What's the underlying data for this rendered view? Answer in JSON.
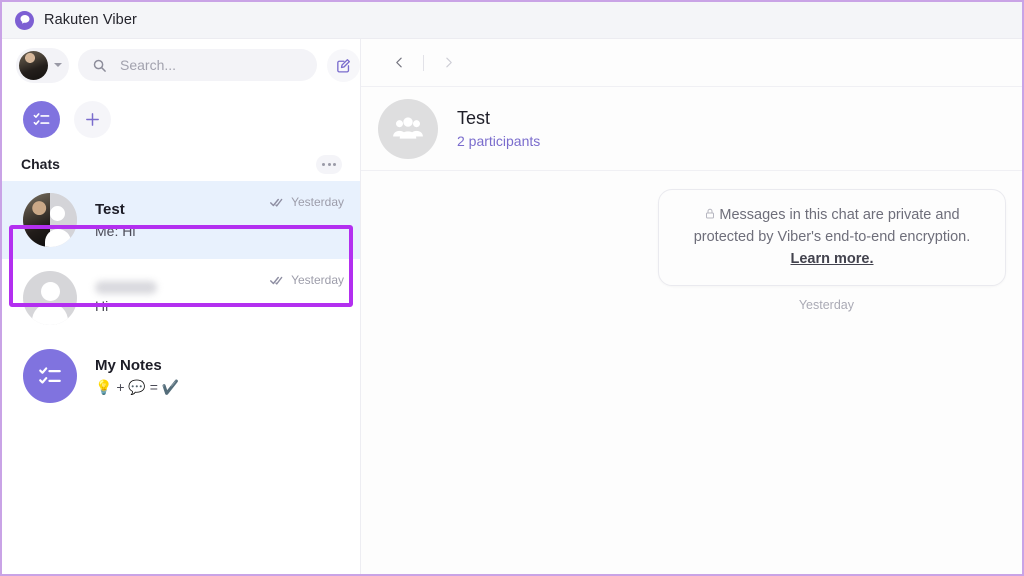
{
  "window": {
    "title": "Rakuten Viber",
    "logo_icon": "viber-phone-icon",
    "border_color": "#c9a3e6"
  },
  "sidebar": {
    "account": {
      "avatar_icon": "user-avatar",
      "dropdown_icon": "chevron-down-icon"
    },
    "search": {
      "icon": "search-icon",
      "placeholder": "Search...",
      "value": ""
    },
    "compose_icon": "compose-message-icon",
    "quick_actions": [
      {
        "name": "my-notes-shortcut",
        "icon": "checklist-icon",
        "color": "#8073df"
      },
      {
        "name": "new-chat-shortcut",
        "icon": "plus-icon",
        "color": "#8073df"
      }
    ],
    "section": {
      "title": "Chats",
      "more_icon": "ellipsis-icon"
    },
    "chats": [
      {
        "name": "Test",
        "preview": "Me: Hi",
        "time": "Yesterday",
        "status_icon": "double-check-icon",
        "avatar": "split-photo-group",
        "selected": true,
        "redacted": false
      },
      {
        "name": "",
        "preview": "Hi",
        "time": "Yesterday",
        "status_icon": "double-check-icon",
        "avatar": "default-person",
        "selected": false,
        "redacted": true
      },
      {
        "name": "My Notes",
        "preview_emoji": "💡 + 💬 = ✔️",
        "time": "",
        "status_icon": "",
        "avatar": "checklist-icon",
        "selected": false,
        "redacted": false
      }
    ],
    "highlight_color": "#b32ff0"
  },
  "conversation": {
    "nav": {
      "back_icon": "chevron-left-icon",
      "forward_icon": "chevron-right-icon"
    },
    "header": {
      "avatar_icon": "group-icon",
      "title": "Test",
      "subtitle": "2 participants",
      "subtitle_color": "#7a6ccd"
    },
    "encryption_notice": {
      "lock_icon": "lock-icon",
      "text": "Messages in this chat are private and protected by Viber's end-to-end encryption. ",
      "link_text": "Learn more."
    },
    "day_divider": "Yesterday"
  }
}
